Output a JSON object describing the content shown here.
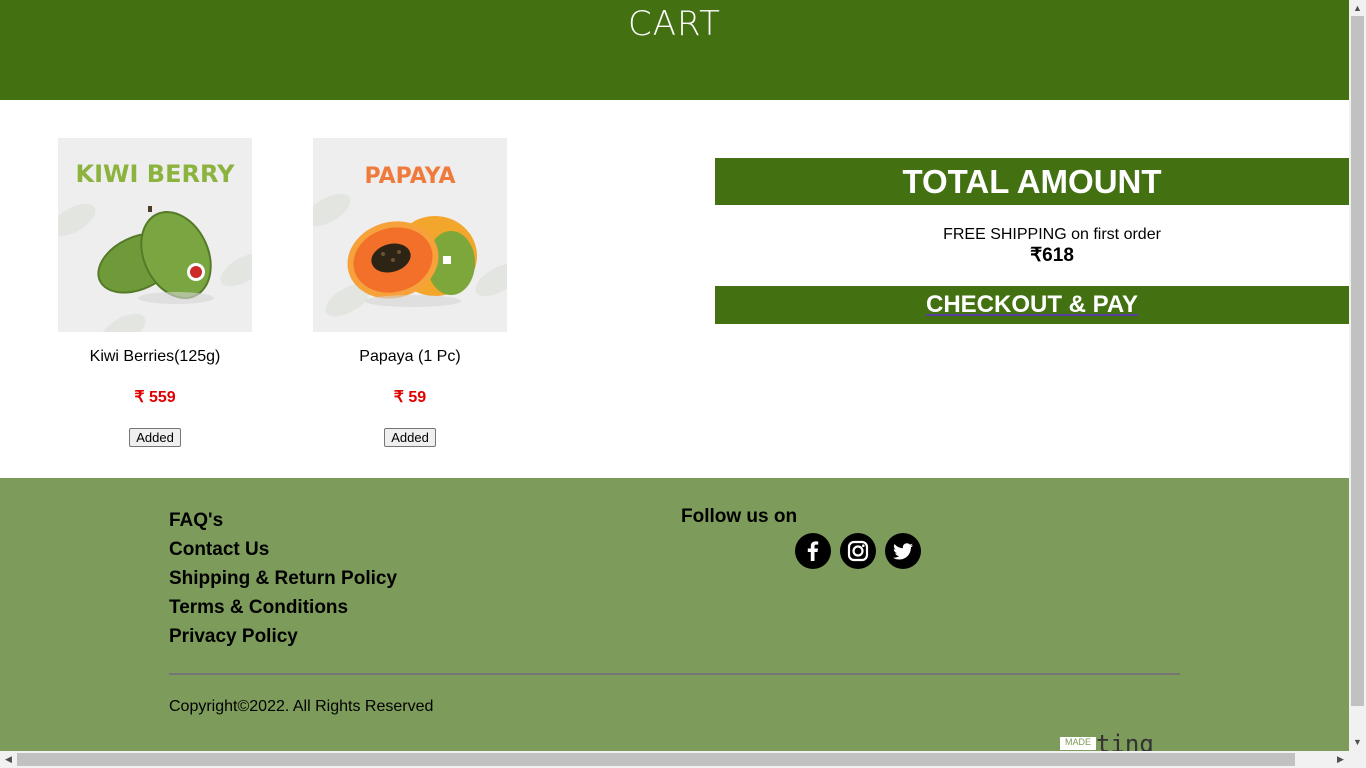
{
  "header": {
    "title": "CART"
  },
  "products": [
    {
      "image_label": "KIWI BERRY",
      "name": "Kiwi Berries(125g)",
      "price": "₹ 559",
      "button": "Added"
    },
    {
      "image_label": "PAPAYA",
      "name": "Papaya (1 Pc)",
      "price": "₹ 59",
      "button": "Added"
    }
  ],
  "summary": {
    "title": "TOTAL AMOUNT",
    "shipping": "FREE SHIPPING on first order",
    "total": "₹618",
    "checkout": "CHECKOUT & PAY"
  },
  "footer": {
    "links": [
      "FAQ's",
      "Contact Us",
      "Shipping & Return Policy",
      "Terms & Conditions",
      "Privacy Policy"
    ],
    "follow": "Follow us on",
    "social": [
      "facebook-icon",
      "instagram-icon",
      "twitter-icon"
    ],
    "copyright": "Copyright©2022. All Rights Reserved",
    "badge_label": "MADE",
    "badge_text": "ting"
  },
  "colors": {
    "header_green": "#437112",
    "footer_green": "#7d9b5a",
    "price_red": "#e00000",
    "kiwi_label": "#8db33f",
    "papaya_label": "#f07a3c"
  }
}
